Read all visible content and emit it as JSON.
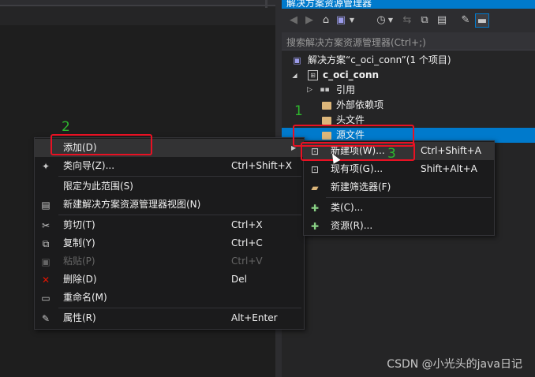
{
  "solution_explorer": {
    "title": "解决方案资源管理器",
    "search_placeholder": "搜索解决方案资源管理器(Ctrl+;)",
    "toolbar_icons": [
      "back-icon",
      "forward-icon",
      "home-icon",
      "solution-icon",
      "dropdown-icon",
      "history-icon",
      "dropdown-icon",
      "sync-icon",
      "collapse-all-icon",
      "show-all-files-icon",
      "properties-wrench-icon",
      "preview-icon"
    ],
    "tree": {
      "solution": "解决方案“c_oci_conn”(1 个项目)",
      "project": "c_oci_conn",
      "items": [
        "引用",
        "外部依赖项",
        "头文件",
        "源文件"
      ]
    }
  },
  "context_menu": {
    "items": [
      {
        "label": "添加(D)",
        "shortcut": ""
      },
      {
        "label": "类向导(Z)...",
        "shortcut": "Ctrl+Shift+X"
      },
      {
        "label": "限定为此范围(S)",
        "shortcut": ""
      },
      {
        "label": "新建解决方案资源管理器视图(N)",
        "shortcut": ""
      },
      {
        "label": "剪切(T)",
        "shortcut": "Ctrl+X"
      },
      {
        "label": "复制(Y)",
        "shortcut": "Ctrl+C"
      },
      {
        "label": "粘贴(P)",
        "shortcut": "Ctrl+V"
      },
      {
        "label": "删除(D)",
        "shortcut": "Del"
      },
      {
        "label": "重命名(M)",
        "shortcut": ""
      },
      {
        "label": "属性(R)",
        "shortcut": "Alt+Enter"
      }
    ]
  },
  "submenu": {
    "items": [
      {
        "label": "新建项(W)...",
        "shortcut": "Ctrl+Shift+A"
      },
      {
        "label": "现有项(G)...",
        "shortcut": "Shift+Alt+A"
      },
      {
        "label": "新建筛选器(F)",
        "shortcut": ""
      },
      {
        "label": "类(C)...",
        "shortcut": ""
      },
      {
        "label": "资源(R)...",
        "shortcut": ""
      }
    ]
  },
  "annotations": {
    "step1": "1",
    "step2": "2",
    "step3": "3"
  },
  "watermark": "CSDN @小光头的java日记",
  "colors": {
    "accent": "#007acc",
    "highlight_box": "#e81123",
    "annotation": "#2eb82e",
    "delete_icon": "#e51400"
  }
}
